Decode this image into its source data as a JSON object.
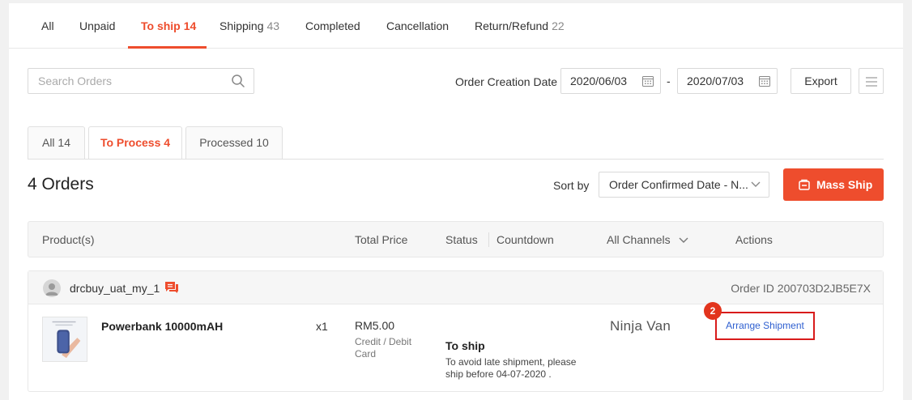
{
  "tabs": [
    {
      "label": "All",
      "count": ""
    },
    {
      "label": "Unpaid",
      "count": ""
    },
    {
      "label": "To ship",
      "count": "14"
    },
    {
      "label": "Shipping",
      "count": "43"
    },
    {
      "label": "Completed",
      "count": ""
    },
    {
      "label": "Cancellation",
      "count": ""
    },
    {
      "label": "Return/Refund",
      "count": "22"
    }
  ],
  "active_tab": "To ship",
  "search": {
    "placeholder": "Search Orders"
  },
  "filters": {
    "date_label": "Order Creation Date",
    "start_date": "2020/06/03",
    "separator": "-",
    "end_date": "2020/07/03",
    "export_label": "Export"
  },
  "subtabs": [
    {
      "label": "All 14"
    },
    {
      "label": "To Process 4"
    },
    {
      "label": "Processed 10"
    }
  ],
  "orders_title": "4 Orders",
  "sort": {
    "label": "Sort by",
    "value": "Order Confirmed Date - N..."
  },
  "mass_ship_label": "Mass Ship",
  "table_headers": {
    "product": "Product(s)",
    "total_price": "Total Price",
    "status": "Status",
    "countdown": "Countdown",
    "channels": "All Channels",
    "actions": "Actions"
  },
  "order": {
    "buyer": "drcbuy_uat_my_1",
    "order_id": "Order ID 200703D2JB5E7X",
    "product_name": "Powerbank 10000mAH",
    "quantity": "x1",
    "price": "RM5.00",
    "payment": "Credit / Debit Card",
    "status": "To ship",
    "status_note": "To avoid late shipment, please ship before 04-07-2020 .",
    "channel": "Ninja Van",
    "action_label": "Arrange Shipment",
    "step_badge": "2"
  },
  "colors": {
    "accent": "#ee4d2d",
    "link": "#2e5fd0",
    "highlight": "#d81b1b"
  }
}
